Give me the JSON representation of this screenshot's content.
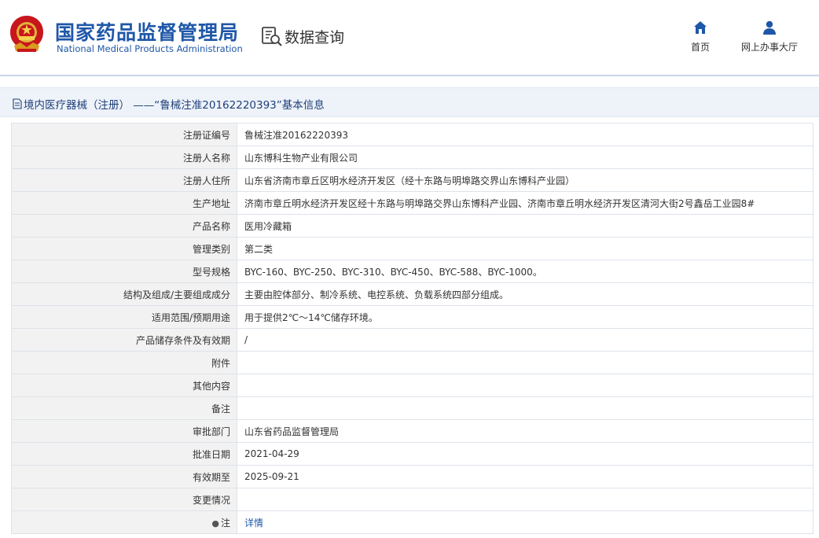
{
  "header": {
    "org_name_cn": "国家药品监督管理局",
    "org_name_en": "National Medical Products Administration",
    "query_label": "数据查询",
    "nav": [
      {
        "label": "首页",
        "icon": "home-icon"
      },
      {
        "label": "网上办事大厅",
        "icon": "user-icon"
      }
    ]
  },
  "breadcrumb": {
    "text": "境内医疗器械（注册） ——“鲁械注准20162220393”基本信息"
  },
  "rows": [
    {
      "label": "注册证编号",
      "value": "鲁械注准20162220393"
    },
    {
      "label": "注册人名称",
      "value": "山东博科生物产业有限公司"
    },
    {
      "label": "注册人住所",
      "value": "山东省济南市章丘区明水经济开发区（经十东路与明埠路交界山东博科产业园）"
    },
    {
      "label": "生产地址",
      "value": "济南市章丘明水经济开发区经十东路与明埠路交界山东博科产业园、济南市章丘明水经济开发区清河大街2号鑫岳工业园8#"
    },
    {
      "label": "产品名称",
      "value": "医用冷藏箱"
    },
    {
      "label": "管理类别",
      "value": "第二类"
    },
    {
      "label": "型号规格",
      "value": "BYC-160、BYC-250、BYC-310、BYC-450、BYC-588、BYC-1000。"
    },
    {
      "label": "结构及组成/主要组成成分",
      "value": "主要由腔体部分、制冷系统、电控系统、负载系统四部分组成。"
    },
    {
      "label": "适用范围/预期用途",
      "value": "用于提供2℃～14℃储存环境。"
    },
    {
      "label": "产品储存条件及有效期",
      "value": "/"
    },
    {
      "label": "附件",
      "value": ""
    },
    {
      "label": "其他内容",
      "value": ""
    },
    {
      "label": "备注",
      "value": ""
    },
    {
      "label": "审批部门",
      "value": "山东省药品监督管理局"
    },
    {
      "label": "批准日期",
      "value": "2021-04-29"
    },
    {
      "label": "有效期至",
      "value": "2025-09-21"
    },
    {
      "label": "变更情况",
      "value": ""
    }
  ],
  "note_row": {
    "label": "注",
    "link": "详情"
  },
  "colors": {
    "brand_blue": "#1f57a8",
    "label_bg": "#f2f2f2",
    "border": "#dde3ea"
  }
}
